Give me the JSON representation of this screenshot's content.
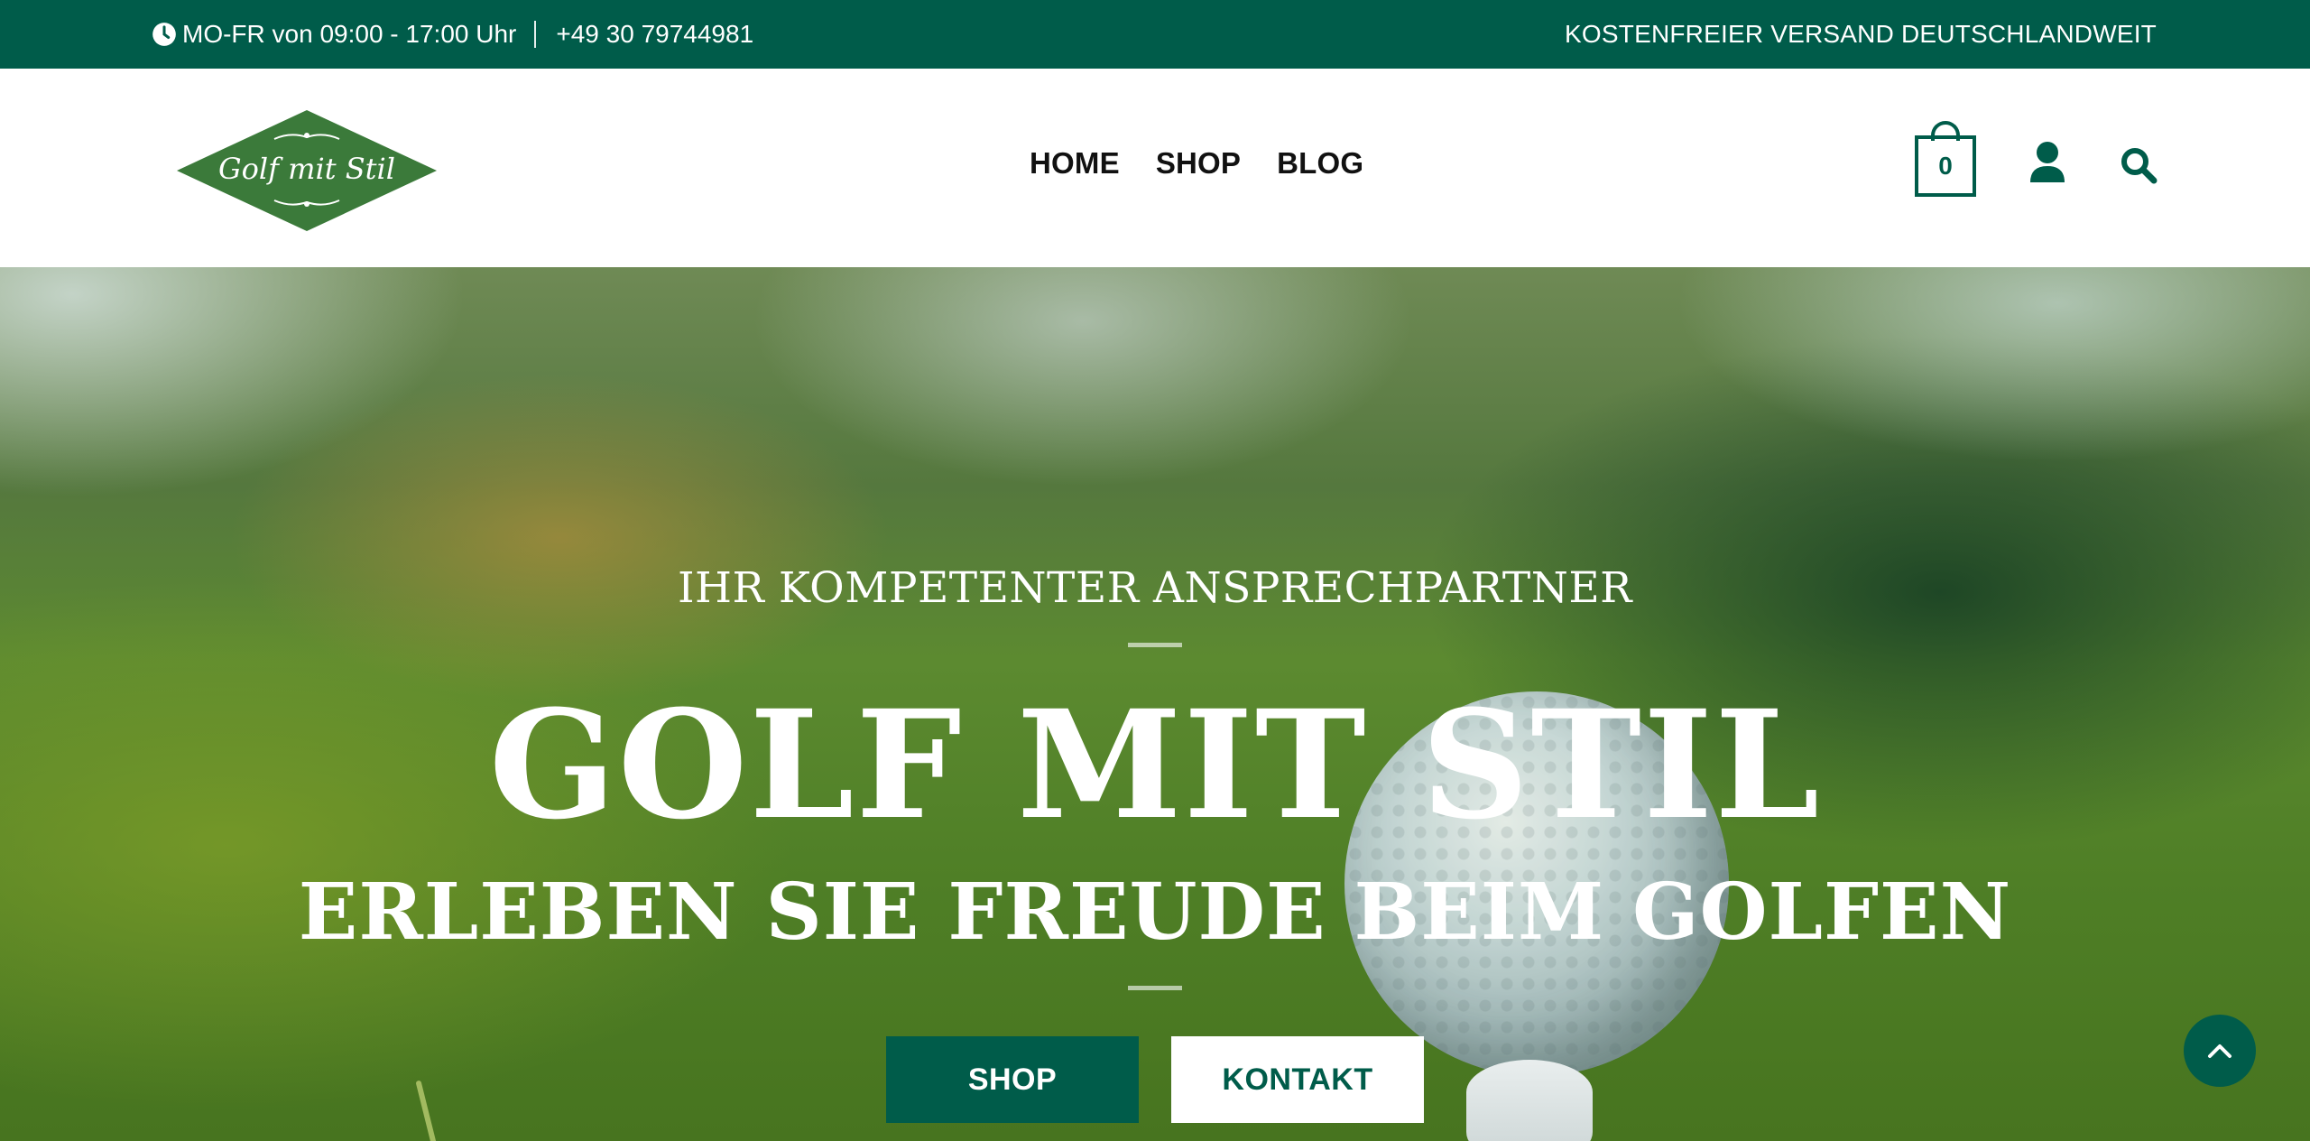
{
  "topbar": {
    "hours": "MO-FR von 09:00 - 17:00 Uhr",
    "phone": "+49  30 79744981",
    "shipping": "KOSTENFREIER VERSAND DEUTSCHLANDWEIT"
  },
  "header": {
    "logo_text": "Golf mit Stil",
    "nav": [
      "HOME",
      "SHOP",
      "BLOG"
    ],
    "cart_count": "0"
  },
  "hero": {
    "kicker": "IHR KOMPETENTER ANSPRECHPARTNER",
    "title": "GOLF MIT STIL",
    "subtitle": "ERLEBEN SIE FREUDE BEIM GOLFEN",
    "button_shop": "SHOP",
    "button_kontakt": "KONTAKT"
  },
  "colors": {
    "brand": "#005c4a",
    "logo_green": "#3b7a3a",
    "white": "#ffffff"
  },
  "icons": [
    "clock-icon",
    "cart-icon",
    "user-icon",
    "search-icon",
    "chevron-up-icon"
  ]
}
